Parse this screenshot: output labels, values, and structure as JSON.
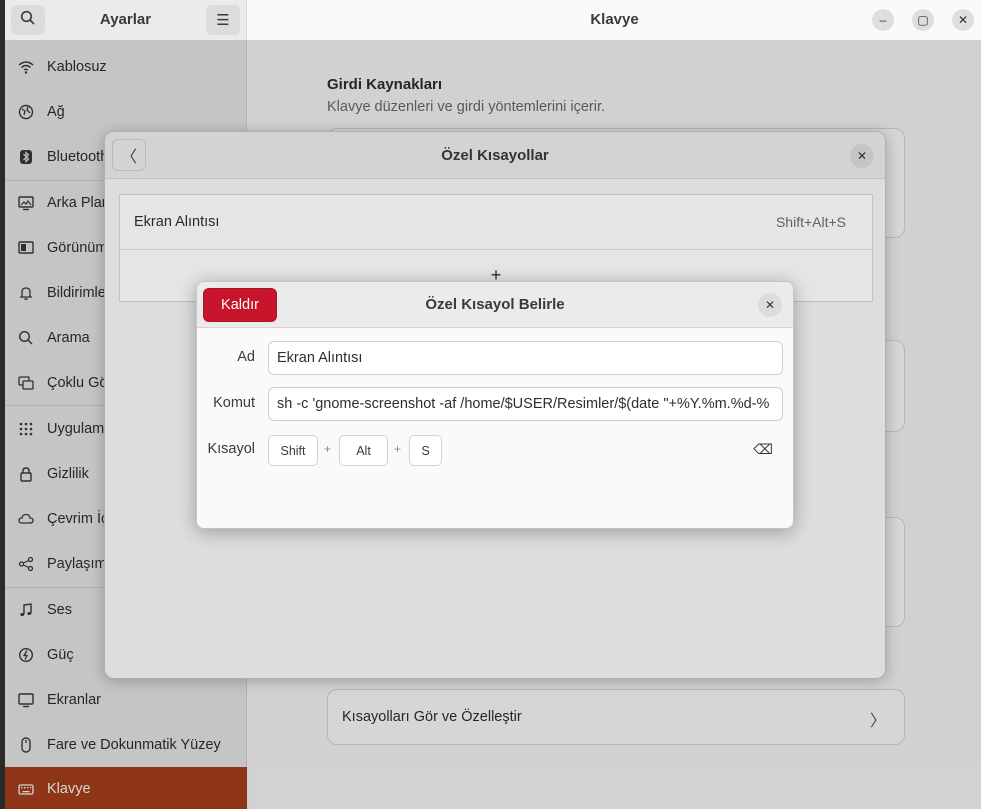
{
  "sidebar": {
    "title": "Ayarlar",
    "items": [
      {
        "label": "Kablosuz",
        "icon": "wifi-icon"
      },
      {
        "label": "Ağ",
        "icon": "network-icon"
      },
      {
        "label": "Bluetooth",
        "icon": "bluetooth-icon"
      },
      {
        "label": "Arka Plan",
        "icon": "background-icon"
      },
      {
        "label": "Görünüm",
        "icon": "appearance-icon"
      },
      {
        "label": "Bildirimler",
        "icon": "notifications-icon"
      },
      {
        "label": "Arama",
        "icon": "search-icon"
      },
      {
        "label": "Çoklu Görev",
        "icon": "multitasking-icon"
      },
      {
        "label": "Uygulamalar",
        "icon": "apps-icon"
      },
      {
        "label": "Gizlilik",
        "icon": "lock-icon"
      },
      {
        "label": "Çevrim İçi Hesaplar",
        "icon": "cloud-icon"
      },
      {
        "label": "Paylaşım",
        "icon": "share-icon"
      },
      {
        "label": "Ses",
        "icon": "music-note-icon"
      },
      {
        "label": "Güç",
        "icon": "power-icon"
      },
      {
        "label": "Ekranlar",
        "icon": "display-icon"
      },
      {
        "label": "Fare ve Dokunmatik Yüzey",
        "icon": "mouse-icon"
      },
      {
        "label": "Klavye",
        "icon": "keyboard-icon"
      }
    ],
    "active": "Klavye"
  },
  "content": {
    "title": "Klavye",
    "section_title": "Girdi Kaynakları",
    "section_subtitle": "Klavye düzenleri ve girdi yöntemlerini içerir.",
    "shortcuts_row_label": "Kısayolları Gör ve Özelleştir"
  },
  "custom_shortcuts_dialog": {
    "title": "Özel Kısayollar",
    "rows": [
      {
        "name": "Ekran Alıntısı",
        "keys": "Shift+Alt+S"
      }
    ],
    "add_symbol": "+"
  },
  "set_shortcut_dialog": {
    "title": "Özel Kısayol Belirle",
    "remove_label": "Kaldır",
    "name_label": "Ad",
    "name_value": "Ekran Alıntısı",
    "command_label": "Komut",
    "command_value": "sh -c 'gnome-screenshot -af /home/$USER/Resimler/$(date \"+%Y.%m.%d-%",
    "shortcut_label": "Kısayol",
    "keys": [
      "Shift",
      "Alt",
      "S"
    ],
    "plus": "+"
  },
  "colors": {
    "accent_active": "#a9401b",
    "destructive": "#c7162b"
  }
}
